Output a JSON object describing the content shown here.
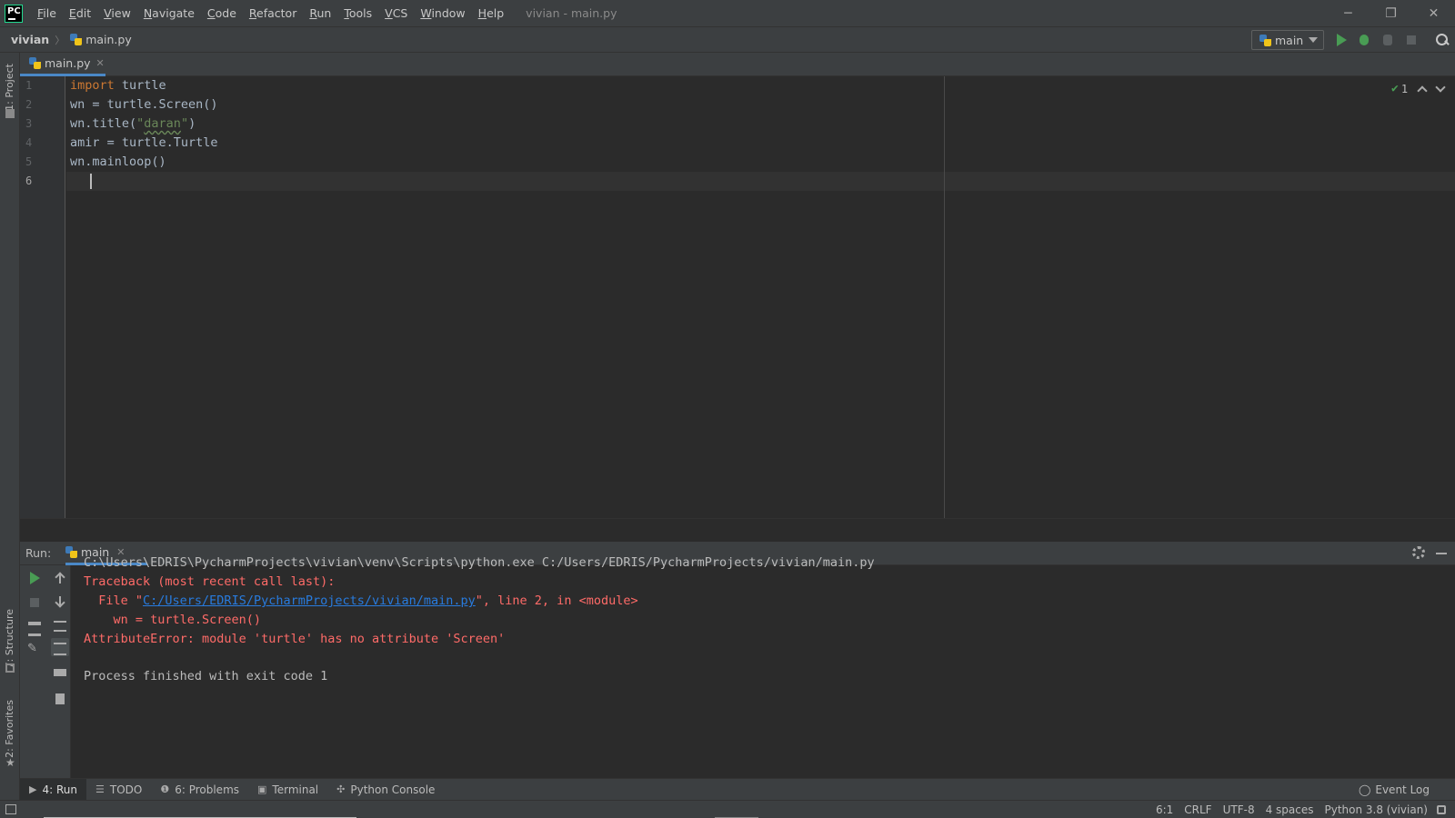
{
  "titlebar": {
    "logo_text": "PC",
    "menu": [
      "File",
      "Edit",
      "View",
      "Navigate",
      "Code",
      "Refactor",
      "Run",
      "Tools",
      "VCS",
      "Window",
      "Help"
    ],
    "window_title": "vivian - main.py",
    "minimize": "─",
    "restore": "❐",
    "close": "✕"
  },
  "navbar": {
    "project": "vivian",
    "file": "main.py",
    "run_config": "main"
  },
  "left_strip": {
    "project": "1: Project",
    "structure": "7: Structure",
    "favorites": "2: Favorites"
  },
  "editor": {
    "tab_label": "main.py",
    "tab_close": "✕",
    "line_numbers": [
      "1",
      "2",
      "3",
      "4",
      "5",
      "6"
    ],
    "code": {
      "l1_kw": "import",
      "l1_rest": " turtle",
      "l2": "wn = turtle.Screen()",
      "l3_pre": "wn.title(",
      "l3_q1": "\"",
      "l3_str": "daran",
      "l3_q2": "\"",
      "l3_post": ")",
      "l4": "amir = turtle.Turtle",
      "l5": "wn.mainloop()"
    },
    "inspection_count": "1",
    "inspection_icon": "check-icon"
  },
  "run_panel": {
    "label": "Run:",
    "tab": "main",
    "tab_close": "✕",
    "console": {
      "cmd": "C:\\Users\\EDRIS\\PycharmProjects\\vivian\\venv\\Scripts\\python.exe C:/Users/EDRIS/PycharmProjects/vivian/main.py",
      "tb1": "Traceback (most recent call last):",
      "tb2_pre": "  File \"",
      "tb2_link": "C:/Users/EDRIS/PycharmProjects/vivian/main.py",
      "tb2_post": "\", line 2, in <module>",
      "tb3": "    wn = turtle.Screen()",
      "tb4": "AttributeError: module 'turtle' has no attribute 'Screen'",
      "exit": "Process finished with exit code 1"
    }
  },
  "bottom_tabs": {
    "run": "4: Run",
    "todo": "TODO",
    "problems": "6: Problems",
    "terminal": "Terminal",
    "python_console": "Python Console",
    "event_log": "Event Log"
  },
  "statusbar": {
    "position": "6:1",
    "line_sep": "CRLF",
    "encoding": "UTF-8",
    "indent": "4 spaces",
    "interpreter": "Python 3.8 (vivian)"
  },
  "colors": {
    "accent": "#4a88c7",
    "error": "#ff6b68",
    "keyword": "#cc7832",
    "string": "#6a8759",
    "run_green": "#499c54"
  }
}
